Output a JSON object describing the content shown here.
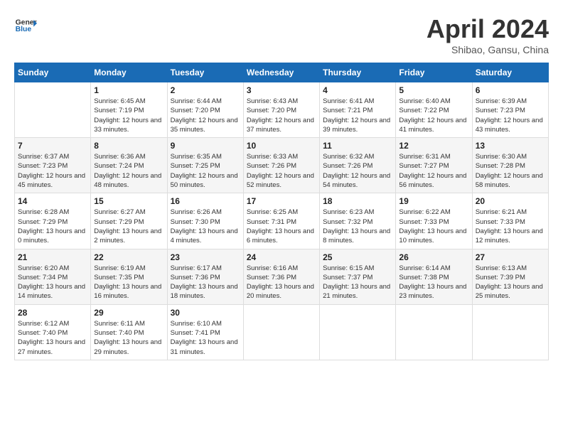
{
  "header": {
    "logo_general": "General",
    "logo_blue": "Blue",
    "title": "April 2024",
    "subtitle": "Shibao, Gansu, China"
  },
  "columns": [
    "Sunday",
    "Monday",
    "Tuesday",
    "Wednesday",
    "Thursday",
    "Friday",
    "Saturday"
  ],
  "weeks": [
    [
      {
        "day": "",
        "sunrise": "",
        "sunset": "",
        "daylight": ""
      },
      {
        "day": "1",
        "sunrise": "Sunrise: 6:45 AM",
        "sunset": "Sunset: 7:19 PM",
        "daylight": "Daylight: 12 hours and 33 minutes."
      },
      {
        "day": "2",
        "sunrise": "Sunrise: 6:44 AM",
        "sunset": "Sunset: 7:20 PM",
        "daylight": "Daylight: 12 hours and 35 minutes."
      },
      {
        "day": "3",
        "sunrise": "Sunrise: 6:43 AM",
        "sunset": "Sunset: 7:20 PM",
        "daylight": "Daylight: 12 hours and 37 minutes."
      },
      {
        "day": "4",
        "sunrise": "Sunrise: 6:41 AM",
        "sunset": "Sunset: 7:21 PM",
        "daylight": "Daylight: 12 hours and 39 minutes."
      },
      {
        "day": "5",
        "sunrise": "Sunrise: 6:40 AM",
        "sunset": "Sunset: 7:22 PM",
        "daylight": "Daylight: 12 hours and 41 minutes."
      },
      {
        "day": "6",
        "sunrise": "Sunrise: 6:39 AM",
        "sunset": "Sunset: 7:23 PM",
        "daylight": "Daylight: 12 hours and 43 minutes."
      }
    ],
    [
      {
        "day": "7",
        "sunrise": "Sunrise: 6:37 AM",
        "sunset": "Sunset: 7:23 PM",
        "daylight": "Daylight: 12 hours and 45 minutes."
      },
      {
        "day": "8",
        "sunrise": "Sunrise: 6:36 AM",
        "sunset": "Sunset: 7:24 PM",
        "daylight": "Daylight: 12 hours and 48 minutes."
      },
      {
        "day": "9",
        "sunrise": "Sunrise: 6:35 AM",
        "sunset": "Sunset: 7:25 PM",
        "daylight": "Daylight: 12 hours and 50 minutes."
      },
      {
        "day": "10",
        "sunrise": "Sunrise: 6:33 AM",
        "sunset": "Sunset: 7:26 PM",
        "daylight": "Daylight: 12 hours and 52 minutes."
      },
      {
        "day": "11",
        "sunrise": "Sunrise: 6:32 AM",
        "sunset": "Sunset: 7:26 PM",
        "daylight": "Daylight: 12 hours and 54 minutes."
      },
      {
        "day": "12",
        "sunrise": "Sunrise: 6:31 AM",
        "sunset": "Sunset: 7:27 PM",
        "daylight": "Daylight: 12 hours and 56 minutes."
      },
      {
        "day": "13",
        "sunrise": "Sunrise: 6:30 AM",
        "sunset": "Sunset: 7:28 PM",
        "daylight": "Daylight: 12 hours and 58 minutes."
      }
    ],
    [
      {
        "day": "14",
        "sunrise": "Sunrise: 6:28 AM",
        "sunset": "Sunset: 7:29 PM",
        "daylight": "Daylight: 13 hours and 0 minutes."
      },
      {
        "day": "15",
        "sunrise": "Sunrise: 6:27 AM",
        "sunset": "Sunset: 7:29 PM",
        "daylight": "Daylight: 13 hours and 2 minutes."
      },
      {
        "day": "16",
        "sunrise": "Sunrise: 6:26 AM",
        "sunset": "Sunset: 7:30 PM",
        "daylight": "Daylight: 13 hours and 4 minutes."
      },
      {
        "day": "17",
        "sunrise": "Sunrise: 6:25 AM",
        "sunset": "Sunset: 7:31 PM",
        "daylight": "Daylight: 13 hours and 6 minutes."
      },
      {
        "day": "18",
        "sunrise": "Sunrise: 6:23 AM",
        "sunset": "Sunset: 7:32 PM",
        "daylight": "Daylight: 13 hours and 8 minutes."
      },
      {
        "day": "19",
        "sunrise": "Sunrise: 6:22 AM",
        "sunset": "Sunset: 7:33 PM",
        "daylight": "Daylight: 13 hours and 10 minutes."
      },
      {
        "day": "20",
        "sunrise": "Sunrise: 6:21 AM",
        "sunset": "Sunset: 7:33 PM",
        "daylight": "Daylight: 13 hours and 12 minutes."
      }
    ],
    [
      {
        "day": "21",
        "sunrise": "Sunrise: 6:20 AM",
        "sunset": "Sunset: 7:34 PM",
        "daylight": "Daylight: 13 hours and 14 minutes."
      },
      {
        "day": "22",
        "sunrise": "Sunrise: 6:19 AM",
        "sunset": "Sunset: 7:35 PM",
        "daylight": "Daylight: 13 hours and 16 minutes."
      },
      {
        "day": "23",
        "sunrise": "Sunrise: 6:17 AM",
        "sunset": "Sunset: 7:36 PM",
        "daylight": "Daylight: 13 hours and 18 minutes."
      },
      {
        "day": "24",
        "sunrise": "Sunrise: 6:16 AM",
        "sunset": "Sunset: 7:36 PM",
        "daylight": "Daylight: 13 hours and 20 minutes."
      },
      {
        "day": "25",
        "sunrise": "Sunrise: 6:15 AM",
        "sunset": "Sunset: 7:37 PM",
        "daylight": "Daylight: 13 hours and 21 minutes."
      },
      {
        "day": "26",
        "sunrise": "Sunrise: 6:14 AM",
        "sunset": "Sunset: 7:38 PM",
        "daylight": "Daylight: 13 hours and 23 minutes."
      },
      {
        "day": "27",
        "sunrise": "Sunrise: 6:13 AM",
        "sunset": "Sunset: 7:39 PM",
        "daylight": "Daylight: 13 hours and 25 minutes."
      }
    ],
    [
      {
        "day": "28",
        "sunrise": "Sunrise: 6:12 AM",
        "sunset": "Sunset: 7:40 PM",
        "daylight": "Daylight: 13 hours and 27 minutes."
      },
      {
        "day": "29",
        "sunrise": "Sunrise: 6:11 AM",
        "sunset": "Sunset: 7:40 PM",
        "daylight": "Daylight: 13 hours and 29 minutes."
      },
      {
        "day": "30",
        "sunrise": "Sunrise: 6:10 AM",
        "sunset": "Sunset: 7:41 PM",
        "daylight": "Daylight: 13 hours and 31 minutes."
      },
      {
        "day": "",
        "sunrise": "",
        "sunset": "",
        "daylight": ""
      },
      {
        "day": "",
        "sunrise": "",
        "sunset": "",
        "daylight": ""
      },
      {
        "day": "",
        "sunrise": "",
        "sunset": "",
        "daylight": ""
      },
      {
        "day": "",
        "sunrise": "",
        "sunset": "",
        "daylight": ""
      }
    ]
  ]
}
